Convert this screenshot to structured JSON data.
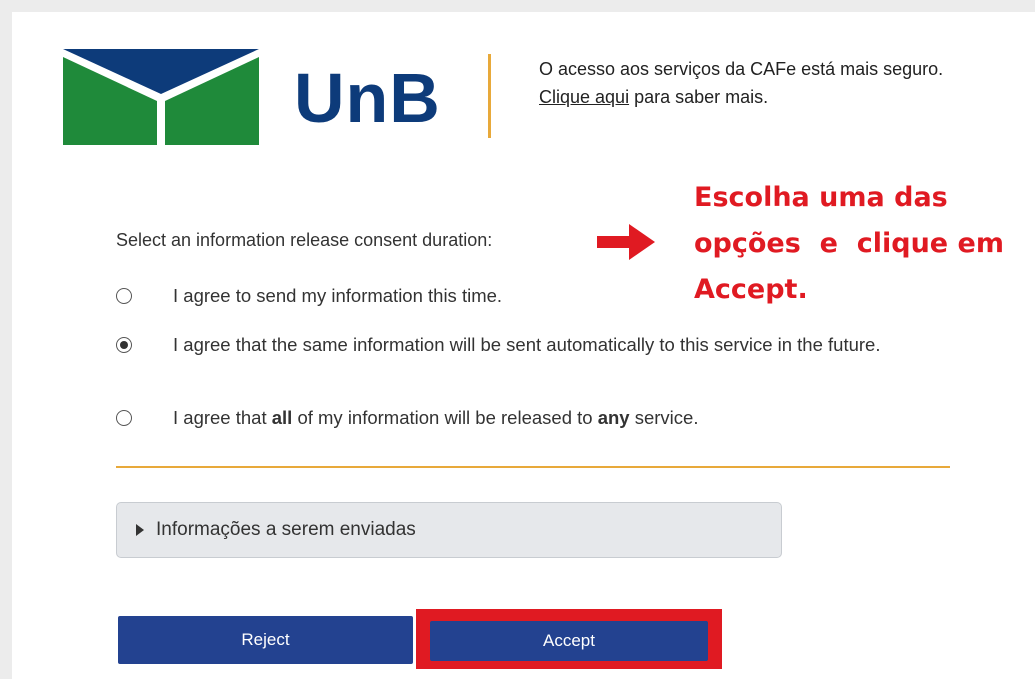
{
  "header": {
    "logo_text": "UnB",
    "notice_line1": "O acesso aos serviços da CAFe está mais seguro.",
    "notice_link": "Clique aqui",
    "notice_line2_rest": " para saber mais."
  },
  "annotation": {
    "lines": [
      "Escolha uma das",
      "opções  e  clique em",
      "Accept."
    ],
    "color": "#e01a22",
    "arrow_icon": "right-arrow-icon"
  },
  "consent": {
    "prompt": "Select an information release consent duration:",
    "options": [
      {
        "pre": "I agree to send my information this time.",
        "checked": false
      },
      {
        "pre": "I agree that the same information will be sent automatically to this service in the future.",
        "checked": true
      },
      {
        "pre": "I agree that ",
        "bold1": "all",
        "mid": " of my information will be released to ",
        "bold2": "any",
        "post": " service.",
        "checked": false
      }
    ]
  },
  "details": {
    "label": "Informações a serem enviadas"
  },
  "buttons": {
    "reject": "Reject",
    "accept": "Accept"
  },
  "colors": {
    "brand_blue": "#0d3b7a",
    "brand_green": "#1f8a3a",
    "button_blue": "#234290",
    "divider_orange": "#e8a93a",
    "highlight_red": "#e01a22"
  }
}
